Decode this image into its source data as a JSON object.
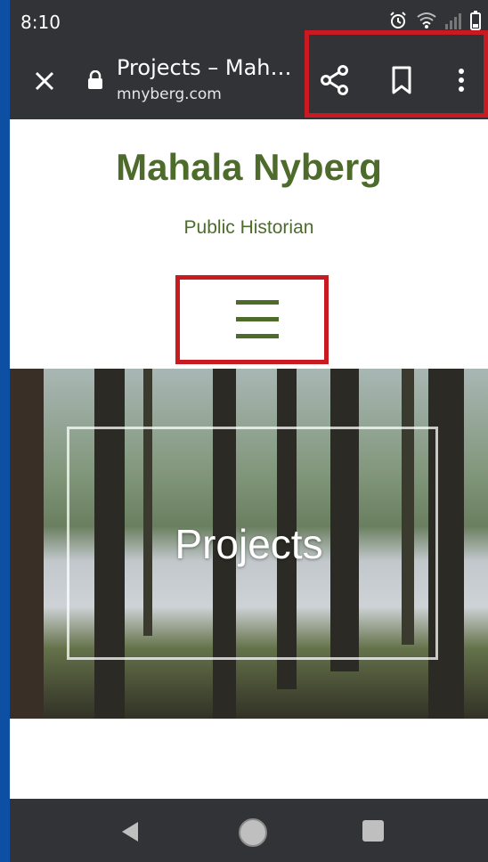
{
  "status_bar": {
    "time": "8:10"
  },
  "browser": {
    "tab_title": "Projects – Mah…",
    "url": "mnyberg.com"
  },
  "site": {
    "title": "Mahala Nyberg",
    "tagline": "Public Historian",
    "hero_title": "Projects"
  },
  "colors": {
    "accent_green": "#4d6b2a",
    "highlight_red": "#c81a20",
    "chrome_dark": "#313336"
  }
}
